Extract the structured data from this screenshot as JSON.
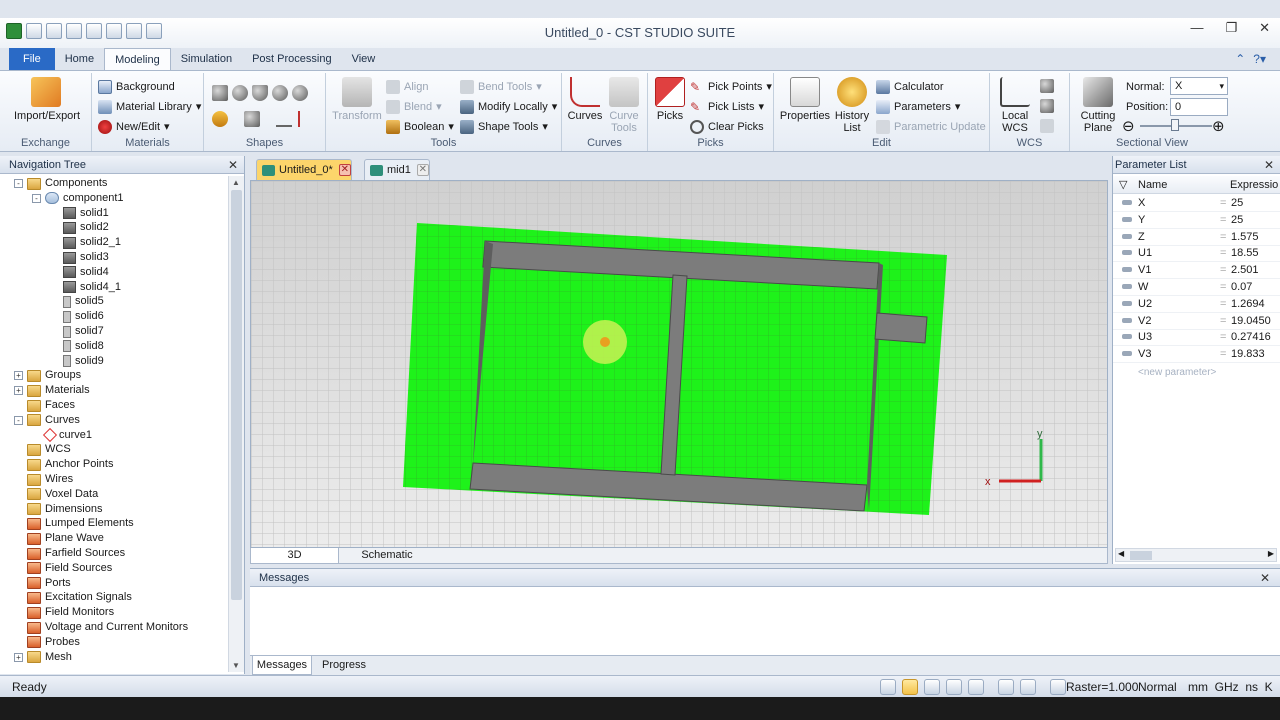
{
  "window": {
    "title": "Untitled_0 - CST STUDIO SUITE",
    "controls": {
      "minimize": "—",
      "maximize": "❐",
      "close": "✕"
    }
  },
  "ribbon_tabs": [
    "File",
    "Home",
    "Modeling",
    "Simulation",
    "Post Processing",
    "View"
  ],
  "ribbon": {
    "exchange": {
      "label": "Exchange",
      "import_export": "Import/Export"
    },
    "materials": {
      "label": "Materials",
      "background": "Background",
      "material_library": "Material Library",
      "new_edit": "New/Edit"
    },
    "shapes": {
      "label": "Shapes"
    },
    "tools": {
      "label": "Tools",
      "transform": "Transform",
      "align": "Align",
      "blend": "Blend",
      "boolean": "Boolean",
      "bend_tools": "Bend Tools",
      "modify_locally": "Modify Locally",
      "shape_tools": "Shape Tools"
    },
    "curves": {
      "label": "Curves",
      "curves": "Curves",
      "curve_tools_1": "Curve",
      "curve_tools_2": "Tools"
    },
    "picks": {
      "label": "Picks",
      "picks": "Picks",
      "pick_points": "Pick Points",
      "pick_lists": "Pick Lists",
      "clear_picks": "Clear Picks"
    },
    "edit": {
      "label": "Edit",
      "properties": "Properties",
      "history_1": "History",
      "history_2": "List",
      "calculator": "Calculator",
      "parameters": "Parameters",
      "parametric_update": "Parametric Update"
    },
    "wcs": {
      "label": "WCS",
      "local_1": "Local",
      "local_2": "WCS"
    },
    "sectional": {
      "label": "Sectional View",
      "cutting_1": "Cutting",
      "cutting_2": "Plane",
      "normal_label": "Normal:",
      "normal_value": "X",
      "position_label": "Position:",
      "position_value": "0",
      "minus": "⊖",
      "plus": "⊕"
    }
  },
  "nav": {
    "title": "Navigation Tree",
    "close": "✕",
    "items": [
      {
        "label": "Components",
        "level": 0,
        "exp": "-",
        "icon": "folder"
      },
      {
        "label": "component1",
        "level": 1,
        "exp": "-",
        "icon": "comp"
      },
      {
        "label": "solid1",
        "level": 2,
        "exp": "",
        "icon": "solid"
      },
      {
        "label": "solid2",
        "level": 2,
        "exp": "",
        "icon": "solid"
      },
      {
        "label": "solid2_1",
        "level": 2,
        "exp": "",
        "icon": "solid"
      },
      {
        "label": "solid3",
        "level": 2,
        "exp": "",
        "icon": "solid"
      },
      {
        "label": "solid4",
        "level": 2,
        "exp": "",
        "icon": "solid"
      },
      {
        "label": "solid4_1",
        "level": 2,
        "exp": "",
        "icon": "solid"
      },
      {
        "label": "solid5",
        "level": 2,
        "exp": "",
        "icon": "flat"
      },
      {
        "label": "solid6",
        "level": 2,
        "exp": "",
        "icon": "flat"
      },
      {
        "label": "solid7",
        "level": 2,
        "exp": "",
        "icon": "flat"
      },
      {
        "label": "solid8",
        "level": 2,
        "exp": "",
        "icon": "flat"
      },
      {
        "label": "solid9",
        "level": 2,
        "exp": "",
        "icon": "flat"
      },
      {
        "label": "Groups",
        "level": 0,
        "exp": "+",
        "icon": "folder"
      },
      {
        "label": "Materials",
        "level": 0,
        "exp": "+",
        "icon": "folder"
      },
      {
        "label": "Faces",
        "level": 0,
        "exp": "",
        "icon": "folder"
      },
      {
        "label": "Curves",
        "level": 0,
        "exp": "-",
        "icon": "folder"
      },
      {
        "label": "curve1",
        "level": 1,
        "exp": "",
        "icon": "curve"
      },
      {
        "label": "WCS",
        "level": 0,
        "exp": "",
        "icon": "folder"
      },
      {
        "label": "Anchor Points",
        "level": 0,
        "exp": "",
        "icon": "folder"
      },
      {
        "label": "Wires",
        "level": 0,
        "exp": "",
        "icon": "folder"
      },
      {
        "label": "Voxel Data",
        "level": 0,
        "exp": "",
        "icon": "folder"
      },
      {
        "label": "Dimensions",
        "level": 0,
        "exp": "",
        "icon": "folder"
      },
      {
        "label": "Lumped Elements",
        "level": 0,
        "exp": "",
        "icon": "red"
      },
      {
        "label": "Plane Wave",
        "level": 0,
        "exp": "",
        "icon": "red"
      },
      {
        "label": "Farfield Sources",
        "level": 0,
        "exp": "",
        "icon": "red"
      },
      {
        "label": "Field Sources",
        "level": 0,
        "exp": "",
        "icon": "red"
      },
      {
        "label": "Ports",
        "level": 0,
        "exp": "",
        "icon": "red"
      },
      {
        "label": "Excitation Signals",
        "level": 0,
        "exp": "",
        "icon": "red"
      },
      {
        "label": "Field Monitors",
        "level": 0,
        "exp": "",
        "icon": "red"
      },
      {
        "label": "Voltage and Current Monitors",
        "level": 0,
        "exp": "",
        "icon": "red"
      },
      {
        "label": "Probes",
        "level": 0,
        "exp": "",
        "icon": "red"
      },
      {
        "label": "Mesh",
        "level": 0,
        "exp": "+",
        "icon": "folder"
      }
    ]
  },
  "doc_tabs": [
    {
      "label": "Untitled_0*",
      "active": true
    },
    {
      "label": "mid1",
      "active": false
    }
  ],
  "view_tabs": [
    "3D",
    "Schematic"
  ],
  "axes": {
    "x": "x",
    "y": "y"
  },
  "params": {
    "title": "Parameter List",
    "close": "✕",
    "col_name": "Name",
    "col_expr": "Expressio",
    "rows": [
      {
        "name": "X",
        "value": "25"
      },
      {
        "name": "Y",
        "value": "25"
      },
      {
        "name": "Z",
        "value": "1.575"
      },
      {
        "name": "U1",
        "value": "18.55"
      },
      {
        "name": "V1",
        "value": "2.501"
      },
      {
        "name": "W",
        "value": "0.07"
      },
      {
        "name": "U2",
        "value": "1.2694"
      },
      {
        "name": "V2",
        "value": "19.0450"
      },
      {
        "name": "U3",
        "value": "0.27416"
      },
      {
        "name": "V3",
        "value": "19.833"
      }
    ],
    "eq": "=",
    "new_param": "<new parameter>"
  },
  "messages": {
    "title": "Messages",
    "close": "✕",
    "tabs": [
      "Messages",
      "Progress"
    ]
  },
  "status": {
    "ready": "Ready",
    "raster": "Raster=1.000",
    "mode": "Normal",
    "units": "mm  GHz  ns  K"
  },
  "colors": {
    "substrate": "#1ef21a",
    "metal": "#7c7c7c",
    "accent": "#2a6ac6"
  }
}
